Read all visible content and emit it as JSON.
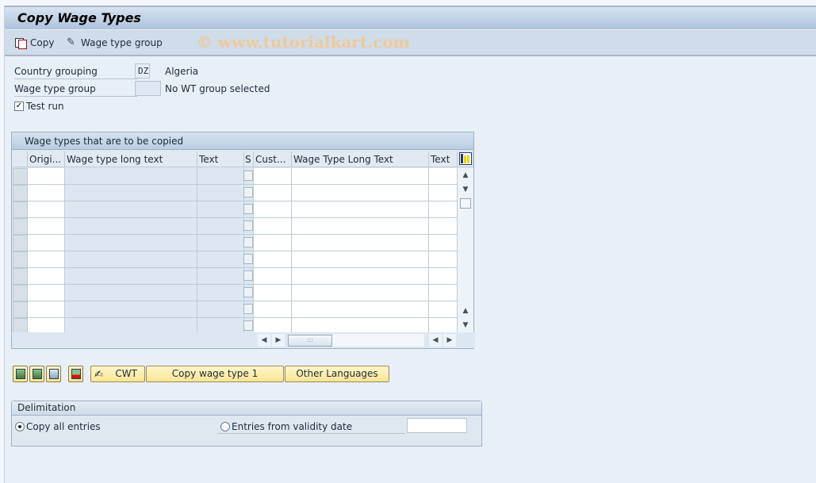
{
  "window": {
    "title": "Copy Wage Types"
  },
  "toolbar": {
    "copy_label": "Copy",
    "wage_type_group_label": "Wage type group",
    "watermark": "© www.tutorialkart.com"
  },
  "form": {
    "country_grouping": {
      "label": "Country grouping",
      "value": "DZ",
      "description": "Algeria"
    },
    "wage_type_group": {
      "label": "Wage type group",
      "value": "",
      "description": "No WT group selected"
    },
    "test_run": {
      "label": "Test run",
      "checked": true,
      "mark": "✓"
    }
  },
  "grid": {
    "title": "Wage types that are to be copied",
    "columns": [
      "Origi...",
      "Wage type long text",
      "Text",
      "S",
      "Cust...",
      "Wage Type Long Text",
      "Text"
    ],
    "row_count": 10,
    "rows": []
  },
  "buttons": {
    "cwt_label": "CWT",
    "copy_wage_type_label": "Copy wage type 1",
    "other_languages_label": "Other Languages"
  },
  "delimitation": {
    "title": "Delimitation",
    "options": [
      {
        "label": "Copy all entries",
        "selected": true
      },
      {
        "label": "Entries from validity date",
        "selected": false
      }
    ],
    "validity_date": ""
  }
}
